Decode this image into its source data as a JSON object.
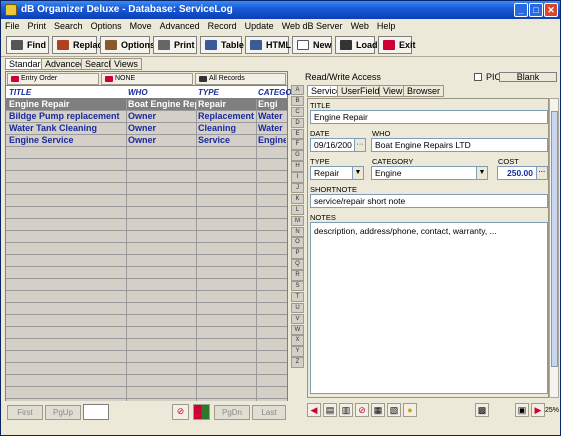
{
  "window": {
    "title": "dB Organizer Deluxe - Database: ServiceLog",
    "minimize": "_",
    "maximize": "□",
    "close": "✕"
  },
  "menu": [
    "File",
    "Print",
    "Search",
    "Options",
    "Move",
    "Advanced",
    "Record",
    "Update",
    "Web dB Server",
    "Web",
    "Help"
  ],
  "toolbar": [
    "Find",
    "Replace",
    "Options",
    "Print",
    "Table",
    "HTML",
    "New",
    "Load",
    "Exit"
  ],
  "view_tabs": [
    "Standard",
    "Advanced",
    "Search",
    "Views"
  ],
  "sort_bar": [
    "Entry Order",
    "NONE",
    "All Records"
  ],
  "columns": [
    "TITLE",
    "WHO",
    "TYPE",
    "CATEGO"
  ],
  "rows": [
    {
      "title": "Engine Repair",
      "who": "Boat Engine Rep",
      "type": "Repair",
      "cat": "Engi",
      "selected": true
    },
    {
      "title": "Bildge Pump replacement",
      "who": "Owner",
      "type": "Replacement",
      "cat": "Water",
      "selected": false
    },
    {
      "title": "Water Tank Cleaning",
      "who": "Owner",
      "type": "Cleaning",
      "cat": "Water",
      "selected": false
    },
    {
      "title": "Engine Service",
      "who": "Owner",
      "type": "Service",
      "cat": "Engine",
      "selected": false
    }
  ],
  "nav": {
    "first": "First",
    "pgup": "PgUp",
    "pgdn": "PgDn",
    "last": "Last"
  },
  "right": {
    "access": "Read/Write Access",
    "pio_label": "PIO",
    "blank_label": "Blank",
    "tabs": [
      "Service",
      "UserFields",
      "View",
      "Browser"
    ],
    "alphabet": [
      "A",
      "B",
      "C",
      "D",
      "E",
      "F",
      "G",
      "H",
      "I",
      "J",
      "K",
      "L",
      "M",
      "N",
      "O",
      "P",
      "Q",
      "R",
      "S",
      "T",
      "U",
      "V",
      "W",
      "X",
      "Y",
      "Z"
    ],
    "labels": {
      "title": "TITLE",
      "date": "DATE",
      "who": "WHO",
      "type": "TYPE",
      "category": "CATEGORY",
      "cost": "COST",
      "shortnote": "SHORTNOTE",
      "notes": "NOTES"
    },
    "values": {
      "title": "Engine Repair",
      "date": "09/16/200",
      "who": "Boat Engine Repairs LTD",
      "type": "Repair",
      "category": "Engine",
      "cost": "250.00",
      "shortnote": "service/repair short note",
      "notes": "description, address/phone, contact, warranty, ..."
    },
    "status_pct": "25%"
  }
}
